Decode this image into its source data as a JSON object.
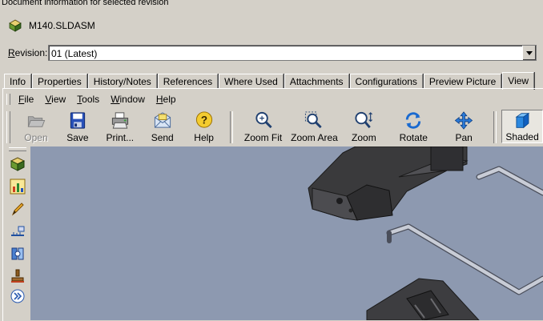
{
  "group_title": "Document information for selected revision",
  "document": {
    "filename": "M140.SLDASM",
    "icon": "assembly-icon"
  },
  "revision": {
    "label_first": "R",
    "label_rest": "evision:",
    "value": "01 (Latest)"
  },
  "tabs": [
    {
      "label": "Info"
    },
    {
      "label": "Properties"
    },
    {
      "label": "History/Notes"
    },
    {
      "label": "References"
    },
    {
      "label": "Where Used"
    },
    {
      "label": "Attachments"
    },
    {
      "label": "Configurations"
    },
    {
      "label": "Preview Picture"
    },
    {
      "label": "View",
      "active": true
    }
  ],
  "menu": [
    {
      "u": "F",
      "rest": "ile"
    },
    {
      "u": "V",
      "rest": "iew"
    },
    {
      "u": "T",
      "rest": "ools"
    },
    {
      "u": "W",
      "rest": "indow"
    },
    {
      "u": "H",
      "rest": "elp"
    }
  ],
  "toolbar": {
    "open": "Open",
    "save": "Save",
    "print": "Print...",
    "send": "Send",
    "help": "Help",
    "zoom_fit": "Zoom Fit",
    "zoom_area": "Zoom Area",
    "zoom": "Zoom",
    "rotate": "Rotate",
    "pan": "Pan",
    "shaded": "Shaded"
  },
  "colors": {
    "viewport_bg": "#8d99b0",
    "part_dark": "#3a3a3c",
    "wire": "#c8ccd6"
  }
}
